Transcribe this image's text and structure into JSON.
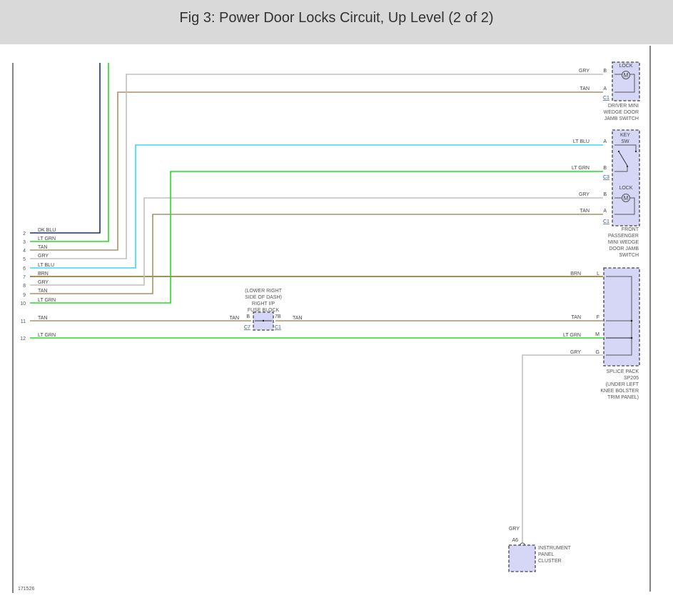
{
  "header": {
    "title": "Fig 3: Power Door Locks Circuit, Up Level (2 of 2)"
  },
  "colors": {
    "dk_blu": "#1c2c8c",
    "lt_grn": "#22dd22",
    "tan": "#a8926a",
    "gry": "#c0c0c0",
    "lt_blu": "#33ddee",
    "brn": "#8a6a20",
    "component_fill": "#d6d6f7",
    "header_bg": "#d9d9d9"
  },
  "left_wires": [
    {
      "pin": "2",
      "color": "DK BLU"
    },
    {
      "pin": "3",
      "color": "LT GRN"
    },
    {
      "pin": "4",
      "color": "TAN"
    },
    {
      "pin": "5",
      "color": "GRY"
    },
    {
      "pin": "6",
      "color": "LT BLU"
    },
    {
      "pin": "7",
      "color": "BRN"
    },
    {
      "pin": "8",
      "color": "GRY"
    },
    {
      "pin": "9",
      "color": "TAN"
    },
    {
      "pin": "10",
      "color": "LT GRN"
    },
    {
      "pin": "11",
      "color": "TAN"
    },
    {
      "pin": "12",
      "color": "LT GRN"
    }
  ],
  "driver_switch": {
    "title": "LOCK",
    "motor": "M",
    "connector": "C1",
    "name": [
      "DRIVER MINI",
      "WEDGE DOOR",
      "JAMB SWITCH"
    ],
    "pins": [
      {
        "wire": "GRY",
        "pin": "B"
      },
      {
        "wire": "TAN",
        "pin": "A"
      }
    ]
  },
  "passenger_switch": {
    "key_title": [
      "KEY",
      "SW"
    ],
    "key_connector": "C3",
    "key_pins": [
      {
        "wire": "LT BLU",
        "pin": "A"
      },
      {
        "wire": "LT GRN",
        "pin": "B"
      }
    ],
    "lock_title": "LOCK",
    "motor": "M",
    "lock_connector": "C1",
    "lock_pins": [
      {
        "wire": "GRY",
        "pin": "B"
      },
      {
        "wire": "TAN",
        "pin": "A"
      }
    ],
    "name": [
      "FRONT",
      "PASSENGER",
      "MINI WEDGE",
      "DOOR JAMB",
      "SWITCH"
    ]
  },
  "fuse_block": {
    "name": [
      "(LOWER RIGHT",
      "SIDE OF DASH)",
      "RIGHT I/P",
      "FUSE BLOCK"
    ],
    "left_wire": "TAN",
    "left_pin": "B",
    "left_connector": "C7",
    "right_wire": "TAN",
    "right_pin": "7B",
    "right_connector": "C1"
  },
  "splice_pack": {
    "name": [
      "SPLICE PACK",
      "SP205",
      "(UNDER LEFT",
      "KNEE BOLSTER",
      "TRIM PANEL)"
    ],
    "pins": [
      {
        "wire": "BRN",
        "pin": "L"
      },
      {
        "wire": "TAN",
        "pin": "F"
      },
      {
        "wire": "LT GRN",
        "pin": "M"
      },
      {
        "wire": "GRY",
        "pin": "G"
      }
    ]
  },
  "instrument_cluster": {
    "wire": "GRY",
    "pin": "A6",
    "name": [
      "INSTRUMENT",
      "PANEL",
      "CLUSTER"
    ]
  },
  "figure_id": "171526"
}
